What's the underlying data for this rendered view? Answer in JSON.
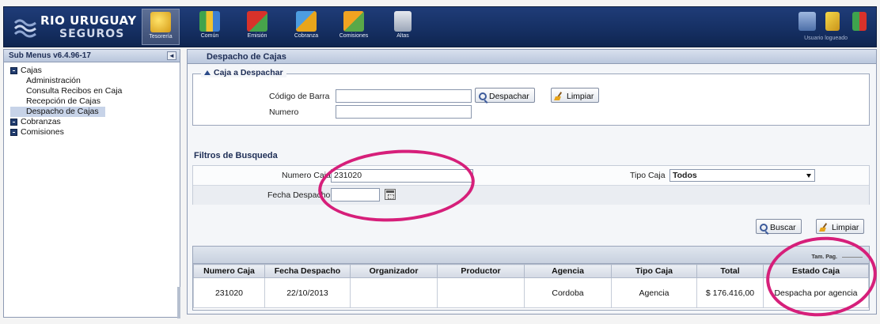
{
  "header": {
    "logo_line1": "RIO URUGUAY",
    "logo_line2": "SEGUROS",
    "modules": [
      {
        "label": "Tesorería",
        "icon": "treasury-icon"
      },
      {
        "label": "Común",
        "icon": "books-icon"
      },
      {
        "label": "Emisión",
        "icon": "emission-icon"
      },
      {
        "label": "Cobranza",
        "icon": "collection-icon"
      },
      {
        "label": "Comisiones",
        "icon": "commission-icon"
      },
      {
        "label": "Altas",
        "icon": "cards-icon"
      }
    ],
    "user_label": "Usuario logueado",
    "right_icons": [
      "computer-icon",
      "key-icon",
      "exit-icon"
    ]
  },
  "sidebar": {
    "title": "Sub Menus v6.4.96-17",
    "collapse_label": "◄",
    "groups": [
      {
        "label": "Cajas",
        "items": [
          "Administración",
          "Consulta Recibos en Caja",
          "Recepción de Cajas",
          "Despacho de Cajas"
        ]
      },
      {
        "label": "Cobranzas",
        "items": []
      },
      {
        "label": "Comisiones",
        "items": []
      }
    ]
  },
  "main": {
    "title": "Despacho de Cajas",
    "caja_section": {
      "legend": "Caja a Despachar",
      "codigo_label": "Código de Barra",
      "codigo_value": "",
      "numero_label": "Numero",
      "numero_value": "",
      "despachar_label": "Despachar",
      "limpiar_label": "Limpiar"
    },
    "filters": {
      "title": "Filtros de Busqueda",
      "numero_caja_label": "Numero Caja",
      "numero_caja_value": "231020",
      "tipo_caja_label": "Tipo Caja",
      "tipo_caja_value": "Todos",
      "fecha_label": "Fecha Despacho",
      "fecha_value": "",
      "buscar_label": "Buscar",
      "limpiar_label": "Limpiar"
    },
    "table": {
      "page_size_label": "Tam. Pag.",
      "columns": [
        "Numero Caja",
        "Fecha Despacho",
        "Organizador",
        "Productor",
        "Agencia",
        "Tipo Caja",
        "Total",
        "Estado Caja"
      ],
      "rows": [
        [
          "231020",
          "22/10/2013",
          "",
          "",
          "Cordoba",
          "Agencia",
          "$ 176.416,00",
          "Despacha por agencia"
        ]
      ]
    }
  },
  "colors": {
    "header_bg": "#163064",
    "highlight": "#d61f7a",
    "panel_head": "#bac7dd"
  }
}
